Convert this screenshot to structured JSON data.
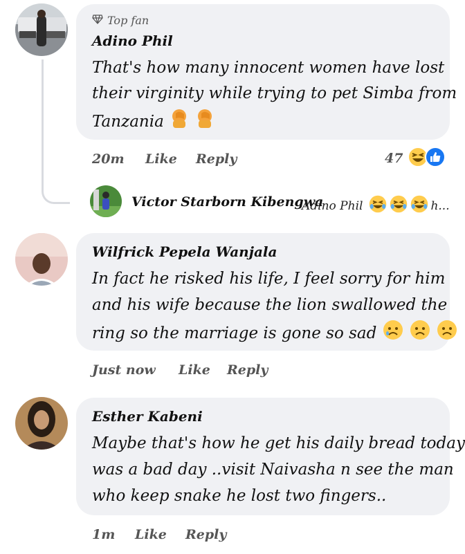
{
  "comments": [
    {
      "badge": "Top fan",
      "author": "Adino Phil",
      "lines": [
        "That's how many innocent women have lost",
        "their virginity while trying to pet Simba from",
        "Tanzania"
      ],
      "time": "20m",
      "like": "Like",
      "reply": "Reply",
      "reaction_count": "47"
    },
    {
      "author": "Wilfrick Pepela Wanjala",
      "lines": [
        "In fact he risked his life, I feel sorry for him",
        "and his wife because the lion swallowed the",
        "ring so the marriage is gone so sad"
      ],
      "time": "Just now",
      "like": "Like",
      "reply": "Reply"
    },
    {
      "author": "Esther Kabeni",
      "lines": [
        "Maybe that's how he get his daily bread today",
        "was a bad day ..visit Naivasha n see the man",
        "who keep snake he lost two fingers.."
      ],
      "time": "1m",
      "like": "Like",
      "reply": "Reply"
    }
  ],
  "reply_preview": {
    "author": "Victor Starborn Kibengwa",
    "mention": "Adino Phil",
    "ellipsis": "h..."
  },
  "icons": {
    "top_fan": "diamond-icon",
    "facepalm": "facepalm-emoji",
    "laugh": "laughing-emoji",
    "like": "like-thumb-icon",
    "sad": "sad-face-emoji"
  },
  "colors": {
    "bubble": "#f0f1f4",
    "meta": "#555555",
    "like_blue": "#1877f2",
    "emoji_yellow": "#ffcc4d"
  }
}
